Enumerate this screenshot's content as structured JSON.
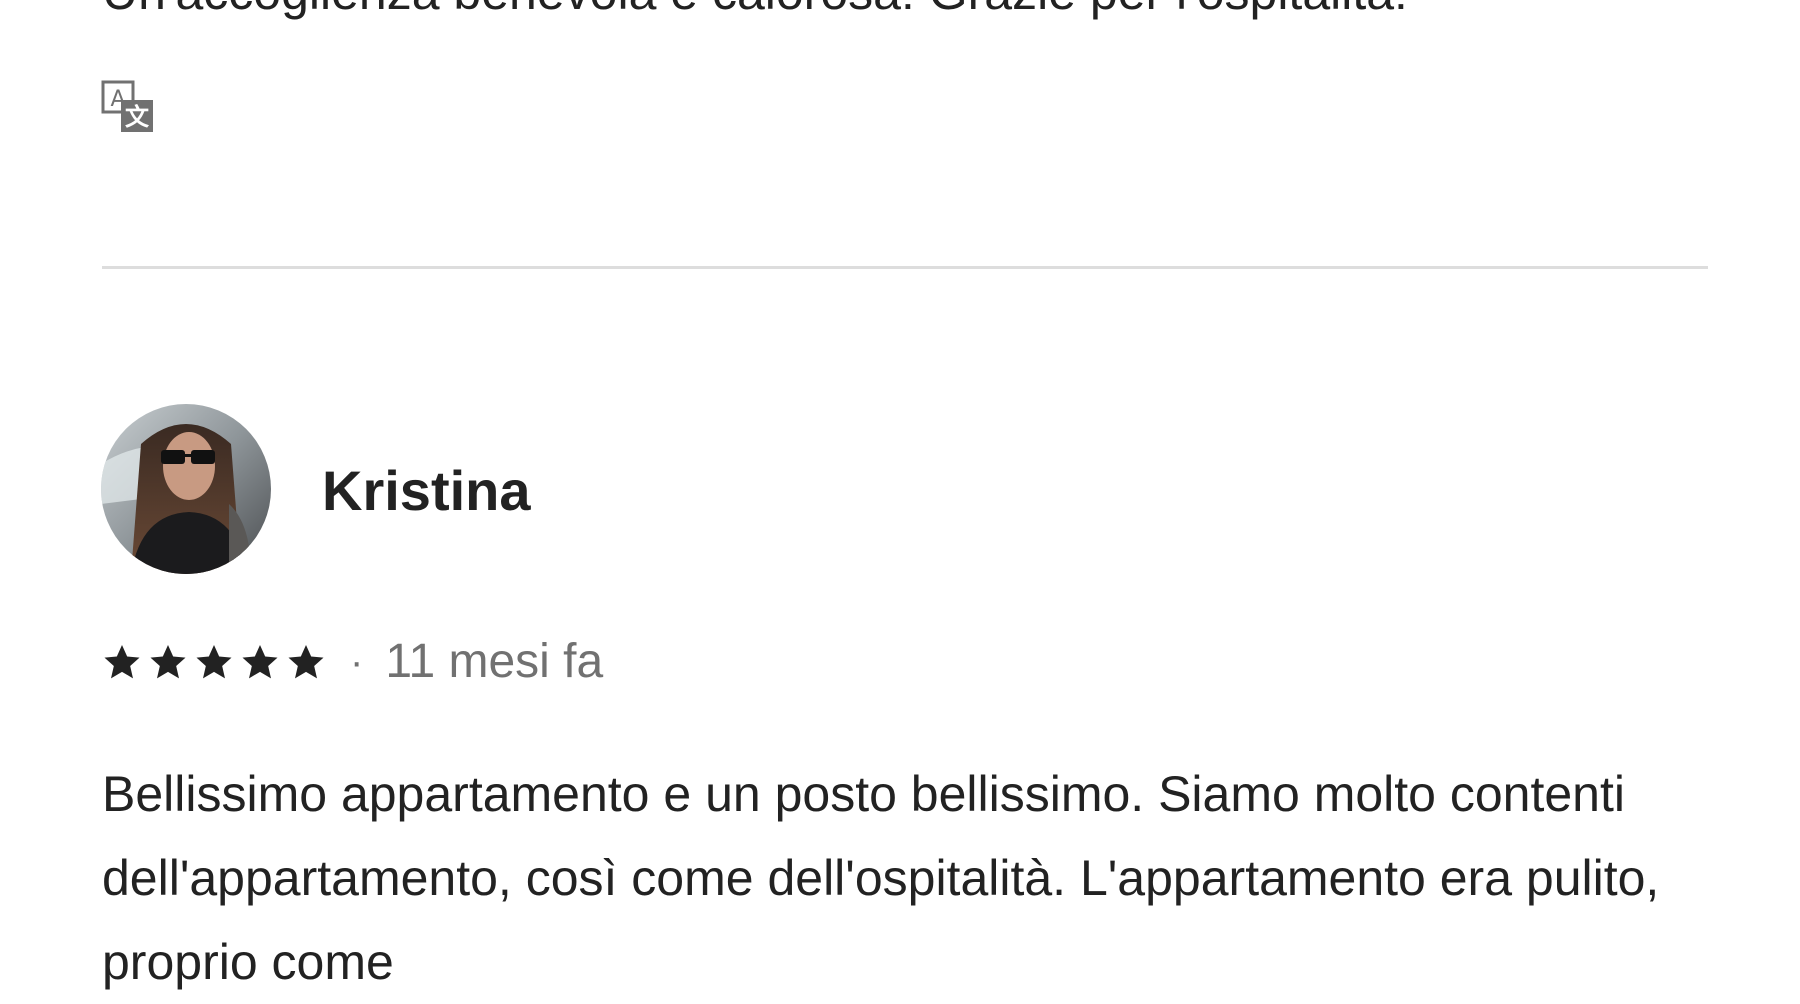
{
  "previous_review": {
    "text": "Un'accoglienza benevola e calorosa! Grazie per l'ospitalità!"
  },
  "icons": {
    "translate": "translate-icon",
    "star": "star-icon"
  },
  "review": {
    "reviewer_name": "Kristina",
    "rating": 5,
    "rating_max": 5,
    "separator": "·",
    "date": "11 mesi fa",
    "text": "Bellissimo appartamento e un posto bellissimo. Siamo molto contenti dell'appartamento, così come dell'ospitalità. L'appartamento era pulito, proprio come"
  },
  "colors": {
    "text_primary": "#222222",
    "text_secondary": "#717171",
    "divider": "#dddddd"
  }
}
